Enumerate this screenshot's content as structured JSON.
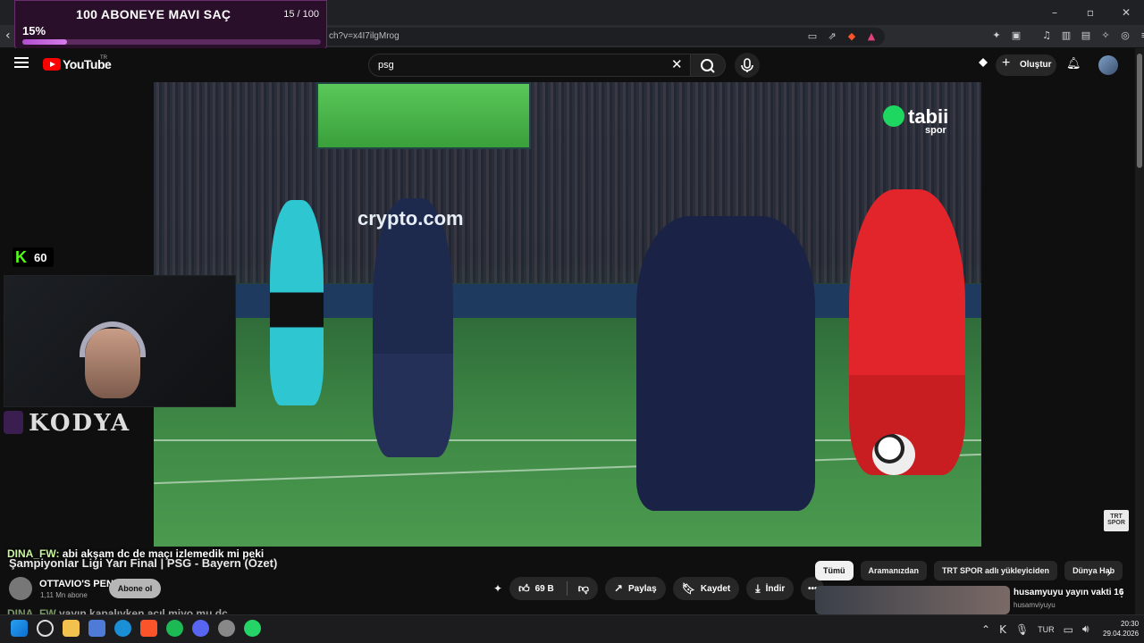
{
  "browser": {
    "url": "ch?v=x4I7ilgMrog",
    "window_controls": {
      "minimize": "–",
      "restore": "▫",
      "close": "✕"
    }
  },
  "goal_overlay": {
    "title": "100 ABONEYE MAVI SAÇ",
    "count": "15 / 100",
    "percent_label": "15%",
    "progress": 0.15
  },
  "youtube": {
    "wordmark": "YouTube",
    "region": "TR",
    "search_value": "psg",
    "create_label": "Oluştur"
  },
  "video_overlay": {
    "tabii": "tabii",
    "tabii_sub": "spor",
    "adboard": "crypto.com",
    "trt_badge": "TRT SPOR"
  },
  "stream": {
    "kick_letter": "K",
    "viewer_count": "60",
    "streamer_name": "KODYA"
  },
  "chat": {
    "line1_user": "DINA_FW:",
    "line1_text": " abi akşam dc de maçı izlemedik mi peki",
    "line2_user": "DINA_FW",
    "line2_text": " yayın kapalıyken açıl miyo mu dc",
    "penalty_text": "OTTAVIO'S PENALTI"
  },
  "video_info": {
    "title": "Şampiyonlar Ligi Yarı Final | PSG - Bayern (Özet)",
    "channel_subs": "1,11 Mn abone",
    "subscribe_label": "Abone ol"
  },
  "actions": {
    "likes": "69 B",
    "share": "Paylaş",
    "save": "Kaydet",
    "download": "İndir",
    "more": "•••"
  },
  "chips": [
    "Tümü",
    "Aramanızdan",
    "TRT SPOR adlı yükleyiciden",
    "Dünya Hab"
  ],
  "recommendation": {
    "title": "husamyuyu yayın vakti 16",
    "channel": "husamviyuyu"
  },
  "taskbar": {
    "lang": "TUR",
    "time": "20:30",
    "date": "29.04.2026"
  },
  "colors": {
    "goal_bg": "#2a0f2b",
    "goal_fill": "#b04fd0",
    "youtube_red": "#ff0000",
    "kick_green": "#53fc18"
  }
}
